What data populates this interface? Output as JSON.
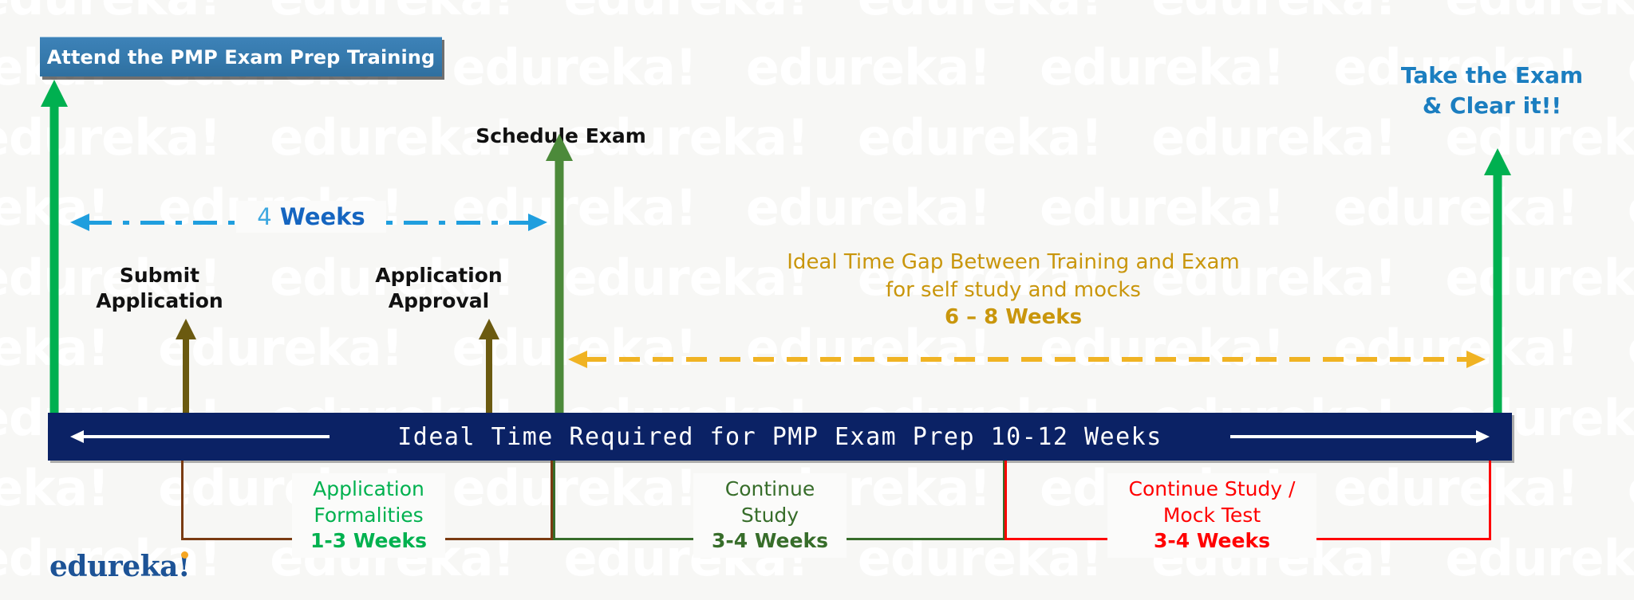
{
  "watermark": {
    "text": "edureka!",
    "repeat": 9,
    "rows": 9
  },
  "colors": {
    "bg": "#f7f7f5",
    "navy_bar": "#0b2265",
    "title_box_blue": "#3579ac",
    "bright_green": "#00b050",
    "olive_green": "#4c8a3a",
    "dark_olive": "#6b5a10",
    "gold_text": "#c9960c",
    "gold_arrow": "#f0b323",
    "cyan_arrow": "#1f9ede",
    "exam_blue": "#1b7ec0",
    "app_green": "#00b14f",
    "study_green": "#376d2a",
    "mock_red": "#ff0000",
    "bracket_brown": "#7a3b12",
    "logo_blue": "#1d5396",
    "logo_dot_orange": "#f5a623"
  },
  "training_box": {
    "label": "Attend the PMP Exam Prep Training"
  },
  "labels": {
    "schedule_exam": "Schedule Exam",
    "submit_application": "Submit\nApplication",
    "submit_application_line1": "Submit",
    "submit_application_line2": "Application",
    "application_approval_line1": "Application",
    "application_approval_line2": "Approval",
    "take_exam_line1": "Take the Exam",
    "take_exam_line2": "& Clear it!!"
  },
  "weeks4_arrow": {
    "number": "4",
    "unit": "Weeks",
    "style": "dash-dot double-headed"
  },
  "gap_note": {
    "line1": "Ideal Time Gap Between Training and Exam",
    "line2": "for self study and mocks",
    "line3": "6 – 8 Weeks"
  },
  "timeline_bar": {
    "text": "Ideal Time Required for PMP Exam Prep 10-12 Weeks"
  },
  "segments": [
    {
      "name": "application-formalities",
      "line1": "Application",
      "line2": "Formalities",
      "weeks": "1-3 Weeks",
      "color": "#00b14f",
      "bracket_color": "#7a3b12"
    },
    {
      "name": "continue-study",
      "line1": "Continue",
      "line2": "Study",
      "weeks": "3-4 Weeks",
      "color": "#376d2a",
      "bracket_color": "#376d2a"
    },
    {
      "name": "continue-study-mock-test",
      "line1": "Continue Study /",
      "line2": "Mock Test",
      "weeks": "3-4 Weeks",
      "color": "#ff0000",
      "bracket_color": "#ff0000"
    }
  ],
  "logo": {
    "text": "edureka",
    "bang": "!"
  }
}
